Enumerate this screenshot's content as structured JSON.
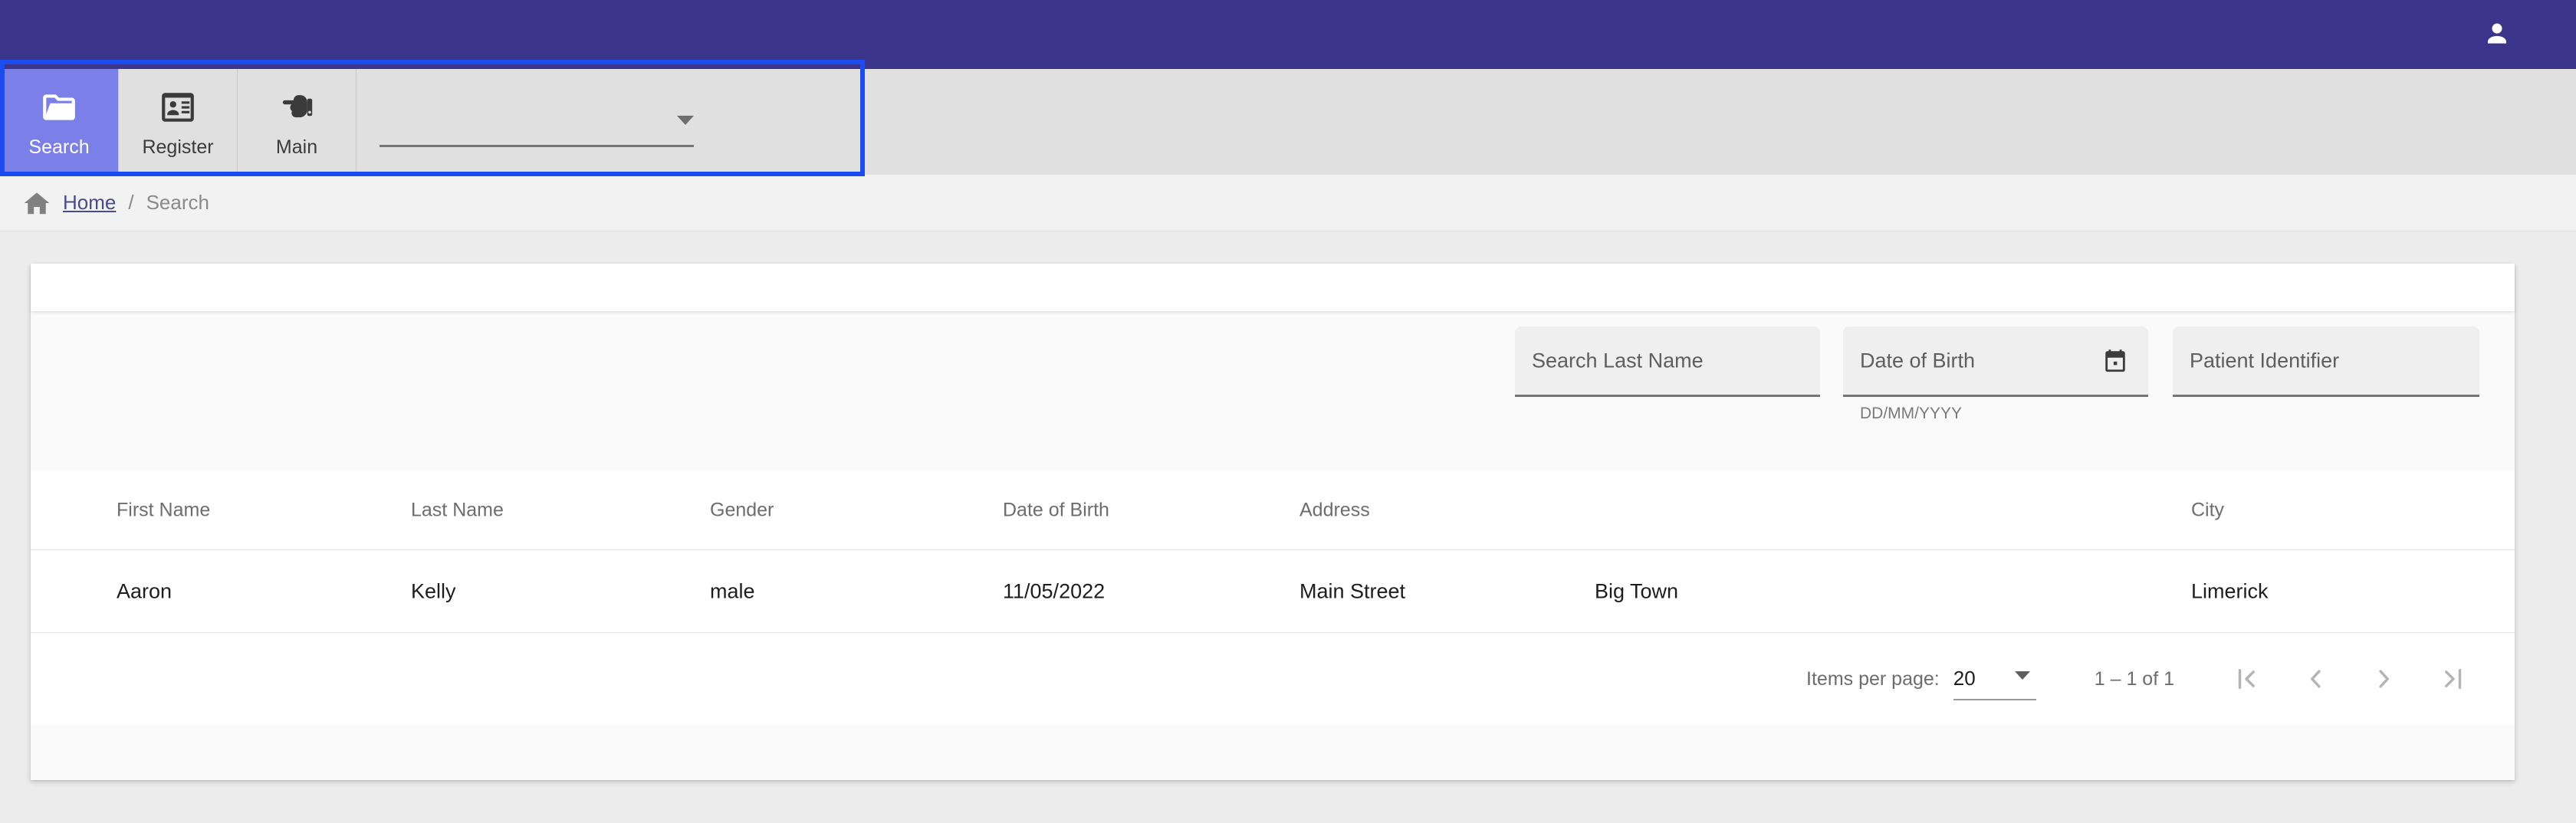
{
  "app": {
    "header": {
      "account_icon": "person-icon"
    },
    "colors": {
      "header_bg": "#3b358c",
      "active_tab_bg": "#7b7fe8",
      "toolbar_bg": "#e0e0e0",
      "focus_outline": "#1a4cf0",
      "breadcrumb_link": "#4a4a8c",
      "page_bg": "#ececec"
    }
  },
  "toolbar": {
    "tabs": [
      {
        "label": "Search",
        "icon": "folder-open-icon",
        "active": true
      },
      {
        "label": "Register",
        "icon": "contact-card-icon",
        "active": false
      },
      {
        "label": "Main",
        "icon": "touch-pointer-hand-icon",
        "active": false
      }
    ],
    "selector": {
      "value": "",
      "icon": "chevron-down-icon"
    }
  },
  "breadcrumb": {
    "home_icon": "home-icon",
    "home_label": "Home",
    "separator": "/",
    "current": "Search"
  },
  "filters": {
    "last_name": {
      "placeholder": "Search Last Name",
      "value": ""
    },
    "dob": {
      "placeholder": "Date of Birth",
      "value": "",
      "hint": "DD/MM/YYYY",
      "icon": "calendar-icon"
    },
    "patient_id": {
      "placeholder": "Patient Identifier",
      "value": ""
    }
  },
  "table": {
    "columns": [
      "First Name",
      "Last Name",
      "Gender",
      "Date of Birth",
      "Address",
      "City"
    ],
    "rows": [
      {
        "first_name": "Aaron",
        "last_name": "Kelly",
        "gender": "male",
        "dob": "11/05/2022",
        "address_line": "Main Street",
        "address_town": "Big Town",
        "city": "Limerick"
      }
    ]
  },
  "paginator": {
    "items_per_page_label": "Items per page:",
    "items_per_page_value": "20",
    "range_label": "1 – 1 of 1",
    "buttons": [
      {
        "name": "first-page",
        "icon": "first-page-icon"
      },
      {
        "name": "previous-page",
        "icon": "chevron-left-icon"
      },
      {
        "name": "next-page",
        "icon": "chevron-right-icon"
      },
      {
        "name": "last-page",
        "icon": "last-page-icon"
      }
    ]
  }
}
